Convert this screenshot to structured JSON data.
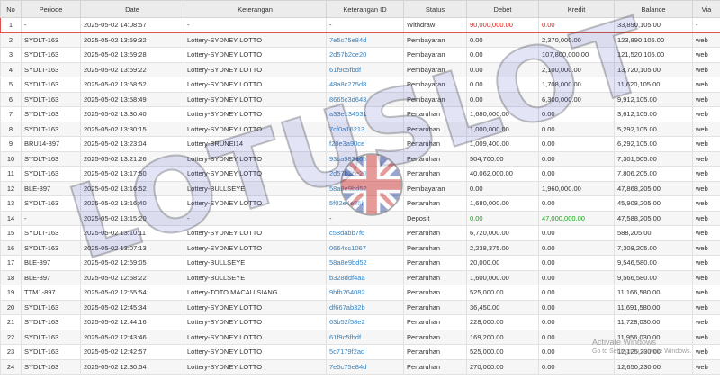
{
  "table": {
    "headers": [
      "No",
      "Periode",
      "Date",
      "Keterangan",
      "Keterangan ID",
      "Status",
      "Debet",
      "Kredit",
      "Balance",
      "Via"
    ],
    "rows": [
      {
        "no": "1",
        "periode": "-",
        "date": "2025-05-02 14:08:57",
        "ket": "-",
        "ket_id": "-",
        "status": "Withdraw",
        "debet": "90,000,000.00",
        "kredit": "0.00",
        "balance": "33,890,105.00",
        "via": "-",
        "highlight": true,
        "debet_class": "red",
        "kredit_class": "red"
      },
      {
        "no": "2",
        "periode": "SYDLT-163",
        "date": "2025-05-02 13:59:32",
        "ket": "Lottery-SYDNEY LOTTO",
        "ket_id": "7e5c75e84d",
        "status": "Pembayaran",
        "debet": "0.00",
        "kredit": "2,370,000.00",
        "balance": "123,890,105.00",
        "via": "web"
      },
      {
        "no": "3",
        "periode": "SYDLT-163",
        "date": "2025-05-02 13:59:28",
        "ket": "Lottery-SYDNEY LOTTO",
        "ket_id": "2d57b2ce20",
        "status": "Pembayaran",
        "debet": "0.00",
        "kredit": "107,800,000.00",
        "balance": "121,520,105.00",
        "via": "web"
      },
      {
        "no": "4",
        "periode": "SYDLT-163",
        "date": "2025-05-02 13:59:22",
        "ket": "Lottery-SYDNEY LOTTO",
        "ket_id": "61f9c5fbdf",
        "status": "Pembayaran",
        "debet": "0.00",
        "kredit": "2,100,000.00",
        "balance": "13,720,105.00",
        "via": "web"
      },
      {
        "no": "5",
        "periode": "SYDLT-163",
        "date": "2025-05-02 13:58:52",
        "ket": "Lottery-SYDNEY LOTTO",
        "ket_id": "48a8c275d8",
        "status": "Pembayaran",
        "debet": "0.00",
        "kredit": "1,708,000.00",
        "balance": "11,620,105.00",
        "via": "web"
      },
      {
        "no": "6",
        "periode": "SYDLT-163",
        "date": "2025-05-02 13:58:49",
        "ket": "Lottery-SYDNEY LOTTO",
        "ket_id": "8665c3d643",
        "status": "Pembayaran",
        "debet": "0.00",
        "kredit": "6,300,000.00",
        "balance": "9,912,105.00",
        "via": "web"
      },
      {
        "no": "7",
        "periode": "SYDLT-163",
        "date": "2025-05-02 13:30:40",
        "ket": "Lottery-SYDNEY LOTTO",
        "ket_id": "a33e134531",
        "status": "Pertaruhan",
        "debet": "1,680,000.00",
        "kredit": "0.00",
        "balance": "3,612,105.00",
        "via": "web"
      },
      {
        "no": "8",
        "periode": "SYDLT-163",
        "date": "2025-05-02 13:30:15",
        "ket": "Lottery-SYDNEY LOTTO",
        "ket_id": "7cf0a16213",
        "status": "Pertaruhan",
        "debet": "1,000,000.00",
        "kredit": "0.00",
        "balance": "5,292,105.00",
        "via": "web"
      },
      {
        "no": "9",
        "periode": "BRU14-897",
        "date": "2025-05-02 13:23:04",
        "ket": "Lottery-BRUNEI14",
        "ket_id": "f28e3a90ce",
        "status": "Pertaruhan",
        "debet": "1,009,400.00",
        "kredit": "0.00",
        "balance": "6,292,105.00",
        "via": "web"
      },
      {
        "no": "10",
        "periode": "SYDLT-163",
        "date": "2025-05-02 13:21:26",
        "ket": "Lottery-SYDNEY LOTTO",
        "ket_id": "93ca983a65",
        "status": "Pertaruhan",
        "debet": "504,700.00",
        "kredit": "0.00",
        "balance": "7,301,505.00",
        "via": "web"
      },
      {
        "no": "11",
        "periode": "SYDLT-163",
        "date": "2025-05-02 13:17:50",
        "ket": "Lottery-SYDNEY LOTTO",
        "ket_id": "2d57b2ce20",
        "status": "Pertaruhan",
        "debet": "40,062,000.00",
        "kredit": "0.00",
        "balance": "7,806,205.00",
        "via": "web"
      },
      {
        "no": "12",
        "periode": "BLE-897",
        "date": "2025-05-02 13:16:52",
        "ket": "Lottery-BULLSEYE",
        "ket_id": "58a8e9bd52",
        "status": "Pembayaran",
        "debet": "0.00",
        "kredit": "1,960,000.00",
        "balance": "47,868,205.00",
        "via": "web"
      },
      {
        "no": "13",
        "periode": "SYDLT-163",
        "date": "2025-05-02 13:16:40",
        "ket": "Lottery-SYDNEY LOTTO",
        "ket_id": "5f02e4e85f",
        "status": "Pertaruhan",
        "debet": "1,680,000.00",
        "kredit": "0.00",
        "balance": "45,908,205.00",
        "via": "web"
      },
      {
        "no": "14",
        "periode": "-",
        "date": "2025-05-02 13:15:20",
        "ket": "-",
        "ket_id": "-",
        "status": "Deposit",
        "debet": "0.00",
        "kredit": "47,000,000.00",
        "balance": "47,588,205.00",
        "via": "web",
        "debet_class": "green",
        "kredit_class": "green"
      },
      {
        "no": "15",
        "periode": "SYDLT-163",
        "date": "2025-05-02 13:10:11",
        "ket": "Lottery-SYDNEY LOTTO",
        "ket_id": "c58dabb7f6",
        "status": "Pertaruhan",
        "debet": "6,720,000.00",
        "kredit": "0.00",
        "balance": "588,205.00",
        "via": "web"
      },
      {
        "no": "16",
        "periode": "SYDLT-163",
        "date": "2025-05-02 13:07:13",
        "ket": "Lottery-SYDNEY LOTTO",
        "ket_id": "0664cc1067",
        "status": "Pertaruhan",
        "debet": "2,238,375.00",
        "kredit": "0.00",
        "balance": "7,308,205.00",
        "via": "web"
      },
      {
        "no": "17",
        "periode": "BLE-897",
        "date": "2025-05-02 12:59:05",
        "ket": "Lottery-BULLSEYE",
        "ket_id": "58a8e9bd52",
        "status": "Pertaruhan",
        "debet": "20,000.00",
        "kredit": "0.00",
        "balance": "9,546,580.00",
        "via": "web"
      },
      {
        "no": "18",
        "periode": "BLE-897",
        "date": "2025-05-02 12:58:22",
        "ket": "Lottery-BULLSEYE",
        "ket_id": "b328ddf4aa",
        "status": "Pertaruhan",
        "debet": "1,600,000.00",
        "kredit": "0.00",
        "balance": "9,566,580.00",
        "via": "web"
      },
      {
        "no": "19",
        "periode": "TTM1-897",
        "date": "2025-05-02 12:55:54",
        "ket": "Lottery-TOTO MACAU SIANG",
        "ket_id": "9bfb764082",
        "status": "Pertaruhan",
        "debet": "525,000.00",
        "kredit": "0.00",
        "balance": "11,166,580.00",
        "via": "web"
      },
      {
        "no": "20",
        "periode": "SYDLT-163",
        "date": "2025-05-02 12:45:34",
        "ket": "Lottery-SYDNEY LOTTO",
        "ket_id": "df667ab32b",
        "status": "Pertaruhan",
        "debet": "36,450.00",
        "kredit": "0.00",
        "balance": "11,691,580.00",
        "via": "web"
      },
      {
        "no": "21",
        "periode": "SYDLT-163",
        "date": "2025-05-02 12:44:16",
        "ket": "Lottery-SYDNEY LOTTO",
        "ket_id": "63b52f58e2",
        "status": "Pertaruhan",
        "debet": "228,000.00",
        "kredit": "0.00",
        "balance": "11,728,030.00",
        "via": "web"
      },
      {
        "no": "22",
        "periode": "SYDLT-163",
        "date": "2025-05-02 12:43:46",
        "ket": "Lottery-SYDNEY LOTTO",
        "ket_id": "61f9c5fbdf",
        "status": "Pertaruhan",
        "debet": "169,200.00",
        "kredit": "0.00",
        "balance": "11,956,030.00",
        "via": "web"
      },
      {
        "no": "23",
        "periode": "SYDLT-163",
        "date": "2025-05-02 12:42:57",
        "ket": "Lottery-SYDNEY LOTTO",
        "ket_id": "5c7179f2ad",
        "status": "Pertaruhan",
        "debet": "525,000.00",
        "kredit": "0.00",
        "balance": "12,125,230.00",
        "via": "web"
      },
      {
        "no": "24",
        "periode": "SYDLT-163",
        "date": "2025-05-02 12:30:54",
        "ket": "Lottery-SYDNEY LOTTO",
        "ket_id": "7e5c75e84d",
        "status": "Pertaruhan",
        "debet": "270,000.00",
        "kredit": "0.00",
        "balance": "12,650,230.00",
        "via": "web"
      }
    ]
  },
  "watermark": {
    "text": "LOTUSLOT"
  },
  "windows_activation": {
    "title": "Activate Windows",
    "subtitle": "Go to Settings to activate Windows."
  },
  "colors": {
    "highlight_border": "#d9534f",
    "id_link": "#2f84c8",
    "withdraw": "#e01b1b",
    "deposit": "#1aa51a"
  }
}
